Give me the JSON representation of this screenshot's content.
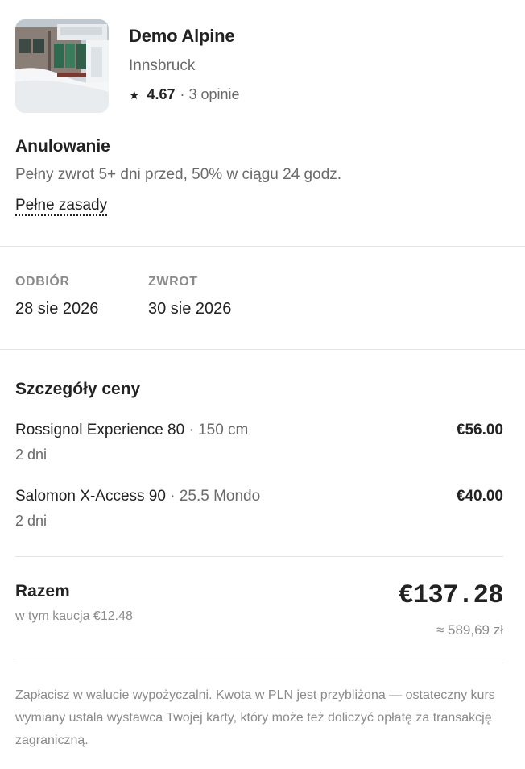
{
  "shop": {
    "name": "Demo Alpine",
    "city": "Innsbruck",
    "rating": "4.67",
    "rating_separator": "·",
    "reviews": "3 opinie",
    "star_icon": "star-icon"
  },
  "cancellation": {
    "title": "Anulowanie",
    "description": "Pełny zwrot 5+ dni przed, 50% w ciągu 24 godz.",
    "policy_link": "Pełne zasady"
  },
  "dates": {
    "pickup_label": "ODBIÓR",
    "pickup_value": "28 sie 2026",
    "return_label": "ZWROT",
    "return_value": "30 sie 2026"
  },
  "price_details": {
    "title": "Szczegóły ceny",
    "items": [
      {
        "name": "Rossignol Experience 80",
        "separator": "·",
        "size": "150 cm",
        "days": "2 dni",
        "price": "€56.00"
      },
      {
        "name": "Salomon X-Access 90",
        "separator": "·",
        "size": "25.5 Mondo",
        "days": "2 dni",
        "price": "€40.00"
      }
    ]
  },
  "total": {
    "label": "Razem",
    "deposit_note": "w tym kaucja €12.48",
    "value": "€137.28",
    "pln_approx": "≈ 589,69 zł"
  },
  "footnote": "Zapłacisz w walucie wypożyczalni. Kwota w PLN jest przybliżona — ostateczny kurs wymiany ustala wystawca Twojej karty, który może też doliczyć opłatę za transakcję zagraniczną.",
  "colors": {
    "primary_text": "#222222",
    "secondary_text": "#6a6a6a",
    "muted_text": "#8a8a8a",
    "divider": "#e4e4e4"
  }
}
